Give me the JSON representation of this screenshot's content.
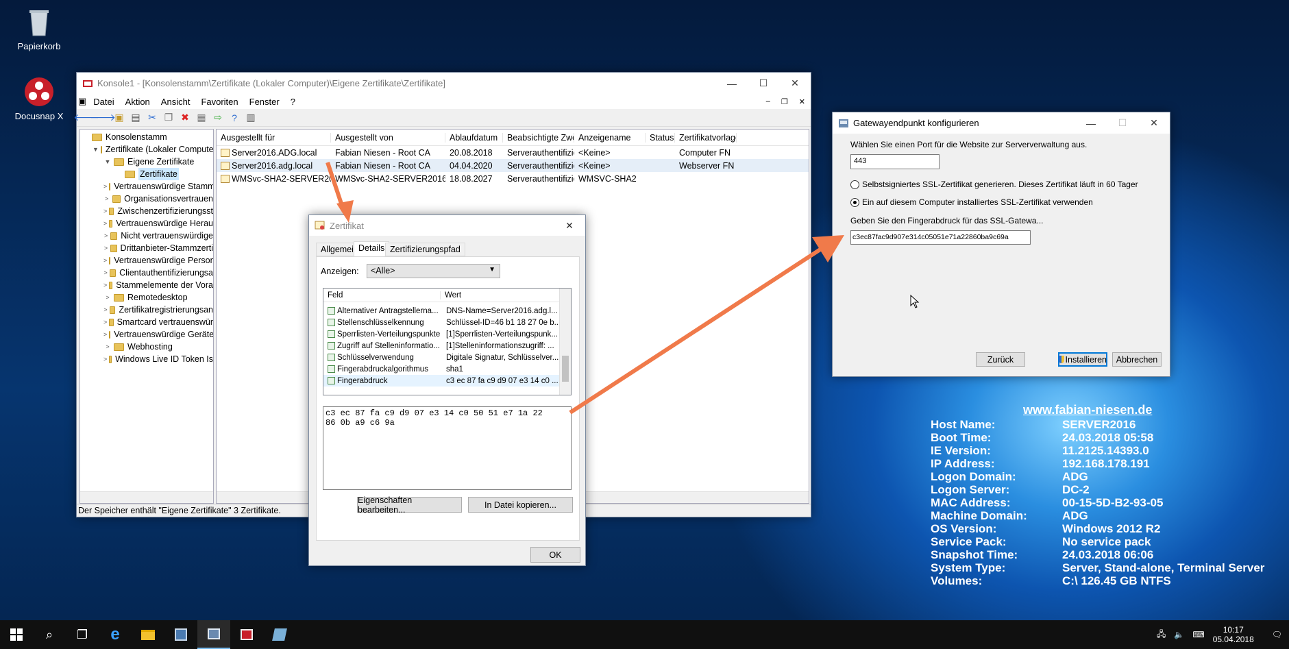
{
  "desktop": {
    "icons": [
      {
        "label": "Papierkorb"
      },
      {
        "label": "Docusnap X"
      }
    ]
  },
  "mmc": {
    "title": "Konsole1 - [Konsolenstamm\\Zertifikate (Lokaler Computer)\\Eigene Zertifikate\\Zertifikate]",
    "menu": [
      "Datei",
      "Aktion",
      "Ansicht",
      "Favoriten",
      "Fenster",
      "?"
    ],
    "tree": [
      {
        "label": "Konsolenstamm",
        "level": 0,
        "chev": ""
      },
      {
        "label": "Zertifikate (Lokaler Compute",
        "level": 1,
        "chev": "▼"
      },
      {
        "label": "Eigene Zertifikate",
        "level": 2,
        "chev": "▼"
      },
      {
        "label": "Zertifikate",
        "level": 3,
        "chev": "",
        "selected": true
      },
      {
        "label": "Vertrauenswürdige Stamm",
        "level": 2,
        "chev": ">"
      },
      {
        "label": "Organisationsvertrauen",
        "level": 2,
        "chev": ">"
      },
      {
        "label": "Zwischenzertifizierungsst",
        "level": 2,
        "chev": ">"
      },
      {
        "label": "Vertrauenswürdige Herau",
        "level": 2,
        "chev": ">"
      },
      {
        "label": "Nicht vertrauenswürdige",
        "level": 2,
        "chev": ">"
      },
      {
        "label": "Drittanbieter-Stammzerti",
        "level": 2,
        "chev": ">"
      },
      {
        "label": "Vertrauenswürdige Person",
        "level": 2,
        "chev": ">"
      },
      {
        "label": "Clientauthentifizierungsa",
        "level": 2,
        "chev": ">"
      },
      {
        "label": "Stammelemente der Vora",
        "level": 2,
        "chev": ">"
      },
      {
        "label": "Remotedesktop",
        "level": 2,
        "chev": ">"
      },
      {
        "label": "Zertifikatregistrierungsan",
        "level": 2,
        "chev": ">"
      },
      {
        "label": "Smartcard vertrauenswür",
        "level": 2,
        "chev": ">"
      },
      {
        "label": "Vertrauenswürdige Geräte",
        "level": 2,
        "chev": ">"
      },
      {
        "label": "Webhosting",
        "level": 2,
        "chev": ">"
      },
      {
        "label": "Windows Live ID Token Is",
        "level": 2,
        "chev": ">"
      }
    ],
    "columns": [
      "Ausgestellt für",
      "Ausgestellt von",
      "Ablaufdatum",
      "Beabsichtigte Zwec...",
      "Anzeigename",
      "Status",
      "Zertifikatvorlage"
    ],
    "rows": [
      [
        "Server2016.ADG.local",
        "Fabian Niesen - Root CA",
        "20.08.2018",
        "Serverauthentifizier...",
        "<Keine>",
        "",
        "Computer FN"
      ],
      [
        "Server2016.adg.local",
        "Fabian Niesen - Root CA",
        "04.04.2020",
        "Serverauthentifizier...",
        "<Keine>",
        "",
        "Webserver FN"
      ],
      [
        "WMSvc-SHA2-SERVER2016",
        "WMSvc-SHA2-SERVER2016",
        "18.08.2027",
        "Serverauthentifizier...",
        "WMSVC-SHA2",
        "",
        ""
      ]
    ],
    "status": "Der Speicher enthält \"Eigene Zertifikate\" 3 Zertifikate."
  },
  "cert": {
    "title": "Zertifikat",
    "tabs": [
      "Allgemein",
      "Details",
      "Zertifizierungspfad"
    ],
    "show_label": "Anzeigen:",
    "show_value": "<Alle>",
    "grid_headers": [
      "Feld",
      "Wert"
    ],
    "grid": [
      [
        "Alternativer Antragstellerna...",
        "DNS-Name=Server2016.adg.l..."
      ],
      [
        "Stellenschlüsselkennung",
        "Schlüssel-ID=46 b1 18 27 0e b..."
      ],
      [
        "Sperrlisten-Verteilungspunkte",
        "[1]Sperrlisten-Verteilungspunk..."
      ],
      [
        "Zugriff auf Stelleninformatio...",
        "[1]Stelleninformationszugriff: ..."
      ],
      [
        "Schlüsselverwendung",
        "Digitale Signatur, Schlüsselver..."
      ],
      [
        "Fingerabdruckalgorithmus",
        "sha1"
      ],
      [
        "Fingerabdruck",
        "c3 ec 87 fa c9 d9 07 e3 14 c0 ..."
      ]
    ],
    "detail_text_1": "c3 ec 87 fa c9 d9 07 e3 14 c0 50 51 e7 1a 22",
    "detail_text_2": "86 0b a9 c6 9a",
    "edit_button": "Eigenschaften bearbeiten...",
    "copy_button": "In Datei kopieren...",
    "ok_button": "OK"
  },
  "gateway": {
    "title": "Gatewayendpunkt konfigurieren",
    "port_label": "Wählen Sie einen Port für die Website zur Serververwaltung aus.",
    "port_value": "443",
    "radio1": "Selbstsigniertes SSL-Zertifikat generieren. Dieses Zertifikat läuft in 60 Tager",
    "radio2": "Ein auf diesem Computer installiertes SSL-Zertifikat verwenden",
    "thumb_label": "Geben Sie den Fingerabdruck für das SSL-Gatewa...",
    "thumb_value": "c3ec87fac9d907e314c05051e71a22860ba9c69a",
    "back_button": "Zurück",
    "install_button": "Installieren",
    "cancel_button": "Abbrechen"
  },
  "bginfo": {
    "url": "www.fabian-niesen.de",
    "items": [
      [
        "Host Name:",
        "SERVER2016"
      ],
      [
        "Boot Time:",
        "24.03.2018 05:58"
      ],
      [
        "IE Version:",
        "11.2125.14393.0"
      ],
      [
        "IP Address:",
        "192.168.178.191"
      ],
      [
        "Logon Domain:",
        "ADG"
      ],
      [
        "Logon Server:",
        "DC-2"
      ],
      [
        "MAC Address:",
        "00-15-5D-B2-93-05"
      ],
      [
        "Machine Domain:",
        "ADG"
      ],
      [
        "OS Version:",
        "Windows 2012 R2"
      ],
      [
        "Service Pack:",
        "No service pack"
      ],
      [
        "Snapshot Time:",
        "24.03.2018 06:06"
      ],
      [
        "System Type:",
        "Server, Stand-alone, Terminal Server"
      ],
      [
        "Volumes:",
        "C:\\ 126.45 GB NTFS"
      ]
    ]
  },
  "taskbar": {
    "time": "10:17",
    "date": "05.04.2018"
  },
  "colors": {
    "arrow": "#f07a4a",
    "accent": "#0078d7"
  }
}
